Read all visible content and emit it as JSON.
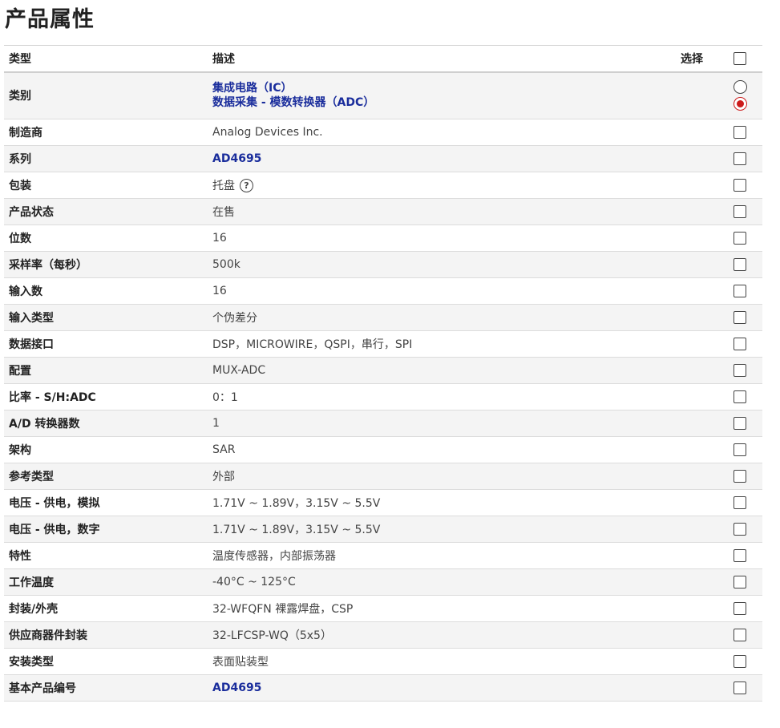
{
  "page": {
    "title": "产品属性"
  },
  "table": {
    "headers": {
      "type": "类型",
      "desc": "描述",
      "select": "选择"
    },
    "category": {
      "label": "类别",
      "links": [
        "集成电路（IC）",
        "数据采集 - 模数转换器（ADC）"
      ]
    },
    "rows": [
      {
        "type": "制造商",
        "desc": "Analog Devices Inc."
      },
      {
        "type": "系列",
        "desc": "AD4695",
        "link": true
      },
      {
        "type": "包装",
        "desc": "托盘",
        "help": "?"
      },
      {
        "type": "产品状态",
        "desc": "在售"
      },
      {
        "type": "位数",
        "desc": "16"
      },
      {
        "type": "采样率（每秒）",
        "desc": "500k"
      },
      {
        "type": "输入数",
        "desc": "16"
      },
      {
        "type": "输入类型",
        "desc": "个伪差分"
      },
      {
        "type": "数据接口",
        "desc": "DSP，MICROWIRE，QSPI，串行，SPI"
      },
      {
        "type": "配置",
        "desc": "MUX-ADC"
      },
      {
        "type": "比率 - S/H:ADC",
        "desc": "0：1"
      },
      {
        "type": "A/D 转换器数",
        "desc": "1"
      },
      {
        "type": "架构",
        "desc": "SAR"
      },
      {
        "type": "参考类型",
        "desc": "外部"
      },
      {
        "type": "电压 - 供电，模拟",
        "desc": "1.71V ~ 1.89V，3.15V ~ 5.5V"
      },
      {
        "type": "电压 - 供电，数字",
        "desc": "1.71V ~ 1.89V，3.15V ~ 5.5V"
      },
      {
        "type": "特性",
        "desc": "温度传感器，内部振荡器"
      },
      {
        "type": "工作温度",
        "desc": "-40°C ~ 125°C"
      },
      {
        "type": "封装/外壳",
        "desc": "32-WFQFN 裸露焊盘，CSP"
      },
      {
        "type": "供应商器件封装",
        "desc": "32-LFCSP-WQ（5x5）"
      },
      {
        "type": "安装类型",
        "desc": "表面贴装型"
      },
      {
        "type": "基本产品编号",
        "desc": "AD4695",
        "link": true
      }
    ]
  },
  "colors": {
    "link": "#1a2d9c",
    "radio_selected": "#cc1a1a",
    "row_alt": "#f4f4f4"
  }
}
